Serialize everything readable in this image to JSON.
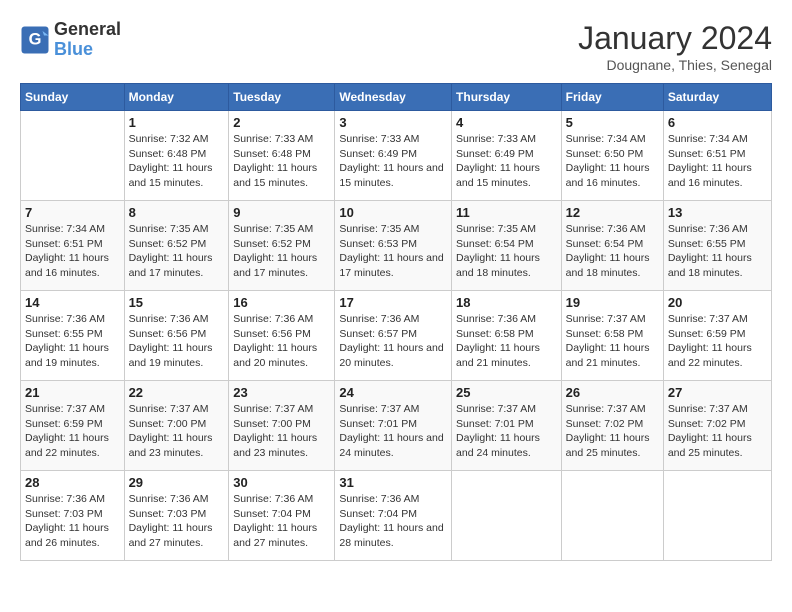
{
  "header": {
    "logo_line1": "General",
    "logo_line2": "Blue",
    "month": "January 2024",
    "location": "Dougnane, Thies, Senegal"
  },
  "weekdays": [
    "Sunday",
    "Monday",
    "Tuesday",
    "Wednesday",
    "Thursday",
    "Friday",
    "Saturday"
  ],
  "weeks": [
    [
      {
        "day": "",
        "sunrise": "",
        "sunset": "",
        "daylight": ""
      },
      {
        "day": "1",
        "sunrise": "Sunrise: 7:32 AM",
        "sunset": "Sunset: 6:48 PM",
        "daylight": "Daylight: 11 hours and 15 minutes."
      },
      {
        "day": "2",
        "sunrise": "Sunrise: 7:33 AM",
        "sunset": "Sunset: 6:48 PM",
        "daylight": "Daylight: 11 hours and 15 minutes."
      },
      {
        "day": "3",
        "sunrise": "Sunrise: 7:33 AM",
        "sunset": "Sunset: 6:49 PM",
        "daylight": "Daylight: 11 hours and 15 minutes."
      },
      {
        "day": "4",
        "sunrise": "Sunrise: 7:33 AM",
        "sunset": "Sunset: 6:49 PM",
        "daylight": "Daylight: 11 hours and 15 minutes."
      },
      {
        "day": "5",
        "sunrise": "Sunrise: 7:34 AM",
        "sunset": "Sunset: 6:50 PM",
        "daylight": "Daylight: 11 hours and 16 minutes."
      },
      {
        "day": "6",
        "sunrise": "Sunrise: 7:34 AM",
        "sunset": "Sunset: 6:51 PM",
        "daylight": "Daylight: 11 hours and 16 minutes."
      }
    ],
    [
      {
        "day": "7",
        "sunrise": "Sunrise: 7:34 AM",
        "sunset": "Sunset: 6:51 PM",
        "daylight": "Daylight: 11 hours and 16 minutes."
      },
      {
        "day": "8",
        "sunrise": "Sunrise: 7:35 AM",
        "sunset": "Sunset: 6:52 PM",
        "daylight": "Daylight: 11 hours and 17 minutes."
      },
      {
        "day": "9",
        "sunrise": "Sunrise: 7:35 AM",
        "sunset": "Sunset: 6:52 PM",
        "daylight": "Daylight: 11 hours and 17 minutes."
      },
      {
        "day": "10",
        "sunrise": "Sunrise: 7:35 AM",
        "sunset": "Sunset: 6:53 PM",
        "daylight": "Daylight: 11 hours and 17 minutes."
      },
      {
        "day": "11",
        "sunrise": "Sunrise: 7:35 AM",
        "sunset": "Sunset: 6:54 PM",
        "daylight": "Daylight: 11 hours and 18 minutes."
      },
      {
        "day": "12",
        "sunrise": "Sunrise: 7:36 AM",
        "sunset": "Sunset: 6:54 PM",
        "daylight": "Daylight: 11 hours and 18 minutes."
      },
      {
        "day": "13",
        "sunrise": "Sunrise: 7:36 AM",
        "sunset": "Sunset: 6:55 PM",
        "daylight": "Daylight: 11 hours and 18 minutes."
      }
    ],
    [
      {
        "day": "14",
        "sunrise": "Sunrise: 7:36 AM",
        "sunset": "Sunset: 6:55 PM",
        "daylight": "Daylight: 11 hours and 19 minutes."
      },
      {
        "day": "15",
        "sunrise": "Sunrise: 7:36 AM",
        "sunset": "Sunset: 6:56 PM",
        "daylight": "Daylight: 11 hours and 19 minutes."
      },
      {
        "day": "16",
        "sunrise": "Sunrise: 7:36 AM",
        "sunset": "Sunset: 6:56 PM",
        "daylight": "Daylight: 11 hours and 20 minutes."
      },
      {
        "day": "17",
        "sunrise": "Sunrise: 7:36 AM",
        "sunset": "Sunset: 6:57 PM",
        "daylight": "Daylight: 11 hours and 20 minutes."
      },
      {
        "day": "18",
        "sunrise": "Sunrise: 7:36 AM",
        "sunset": "Sunset: 6:58 PM",
        "daylight": "Daylight: 11 hours and 21 minutes."
      },
      {
        "day": "19",
        "sunrise": "Sunrise: 7:37 AM",
        "sunset": "Sunset: 6:58 PM",
        "daylight": "Daylight: 11 hours and 21 minutes."
      },
      {
        "day": "20",
        "sunrise": "Sunrise: 7:37 AM",
        "sunset": "Sunset: 6:59 PM",
        "daylight": "Daylight: 11 hours and 22 minutes."
      }
    ],
    [
      {
        "day": "21",
        "sunrise": "Sunrise: 7:37 AM",
        "sunset": "Sunset: 6:59 PM",
        "daylight": "Daylight: 11 hours and 22 minutes."
      },
      {
        "day": "22",
        "sunrise": "Sunrise: 7:37 AM",
        "sunset": "Sunset: 7:00 PM",
        "daylight": "Daylight: 11 hours and 23 minutes."
      },
      {
        "day": "23",
        "sunrise": "Sunrise: 7:37 AM",
        "sunset": "Sunset: 7:00 PM",
        "daylight": "Daylight: 11 hours and 23 minutes."
      },
      {
        "day": "24",
        "sunrise": "Sunrise: 7:37 AM",
        "sunset": "Sunset: 7:01 PM",
        "daylight": "Daylight: 11 hours and 24 minutes."
      },
      {
        "day": "25",
        "sunrise": "Sunrise: 7:37 AM",
        "sunset": "Sunset: 7:01 PM",
        "daylight": "Daylight: 11 hours and 24 minutes."
      },
      {
        "day": "26",
        "sunrise": "Sunrise: 7:37 AM",
        "sunset": "Sunset: 7:02 PM",
        "daylight": "Daylight: 11 hours and 25 minutes."
      },
      {
        "day": "27",
        "sunrise": "Sunrise: 7:37 AM",
        "sunset": "Sunset: 7:02 PM",
        "daylight": "Daylight: 11 hours and 25 minutes."
      }
    ],
    [
      {
        "day": "28",
        "sunrise": "Sunrise: 7:36 AM",
        "sunset": "Sunset: 7:03 PM",
        "daylight": "Daylight: 11 hours and 26 minutes."
      },
      {
        "day": "29",
        "sunrise": "Sunrise: 7:36 AM",
        "sunset": "Sunset: 7:03 PM",
        "daylight": "Daylight: 11 hours and 27 minutes."
      },
      {
        "day": "30",
        "sunrise": "Sunrise: 7:36 AM",
        "sunset": "Sunset: 7:04 PM",
        "daylight": "Daylight: 11 hours and 27 minutes."
      },
      {
        "day": "31",
        "sunrise": "Sunrise: 7:36 AM",
        "sunset": "Sunset: 7:04 PM",
        "daylight": "Daylight: 11 hours and 28 minutes."
      },
      {
        "day": "",
        "sunrise": "",
        "sunset": "",
        "daylight": ""
      },
      {
        "day": "",
        "sunrise": "",
        "sunset": "",
        "daylight": ""
      },
      {
        "day": "",
        "sunrise": "",
        "sunset": "",
        "daylight": ""
      }
    ]
  ]
}
